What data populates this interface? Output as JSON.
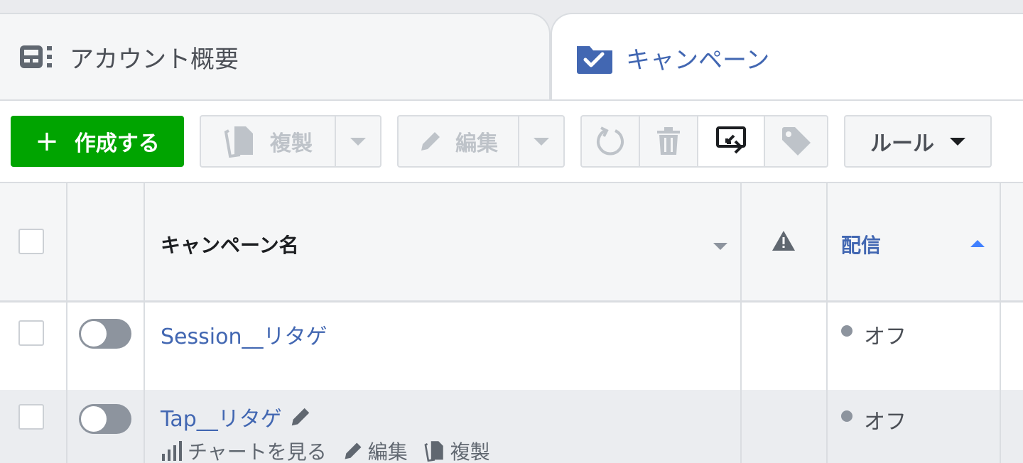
{
  "tabs": {
    "account_overview": {
      "label": "アカウント概要",
      "icon": "account-overview-icon"
    },
    "campaigns": {
      "label": "キャンペーン",
      "icon": "campaign-folder-icon"
    }
  },
  "toolbar": {
    "create_label": "作成する",
    "duplicate_label": "複製",
    "edit_label": "編集",
    "rules_label": "ルール"
  },
  "table": {
    "headers": {
      "campaign_name": "キャンペーン名",
      "delivery": "配信"
    },
    "rows": [
      {
        "name": "Session__リタゲ",
        "status": "オフ",
        "toggle_on": false
      },
      {
        "name": "Tap__リタゲ",
        "status": "オフ",
        "toggle_on": false,
        "actions": {
          "view_chart": "チャートを見る",
          "edit": "編集",
          "duplicate": "複製"
        }
      }
    ]
  },
  "colors": {
    "create_button": "#00a400",
    "link_blue": "#4267b2",
    "sort_accent": "#4080ff"
  }
}
